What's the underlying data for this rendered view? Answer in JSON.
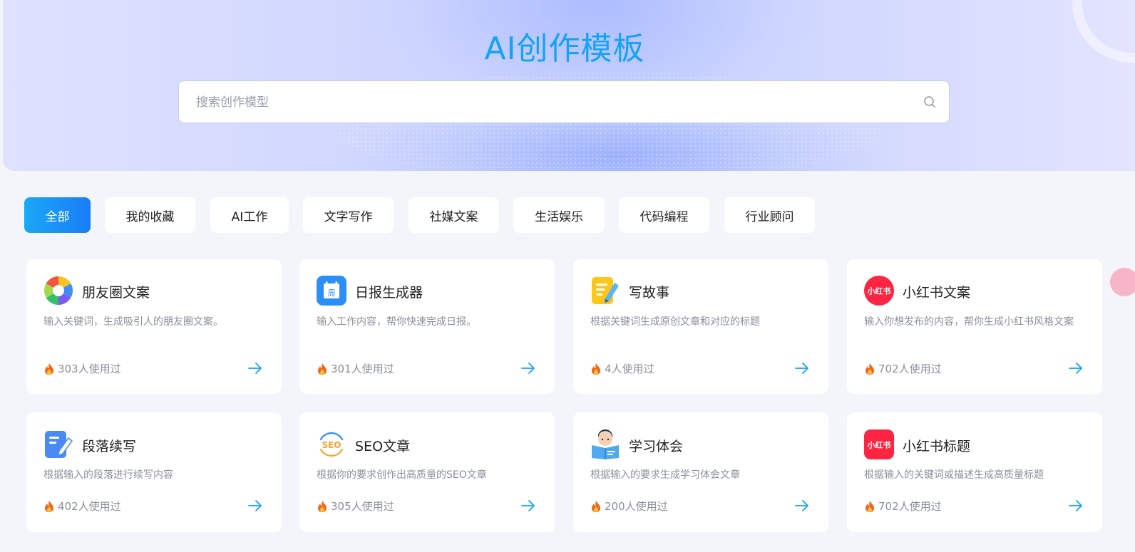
{
  "header": {
    "title": "AI创作模板",
    "search_placeholder": "搜索创作模型",
    "search_icon": "search-icon"
  },
  "tabs": [
    {
      "label": "全部",
      "active": true
    },
    {
      "label": "我的收藏",
      "active": false
    },
    {
      "label": "AI工作",
      "active": false
    },
    {
      "label": "文字写作",
      "active": false
    },
    {
      "label": "社媒文案",
      "active": false
    },
    {
      "label": "生活娱乐",
      "active": false
    },
    {
      "label": "代码编程",
      "active": false
    },
    {
      "label": "行业顾问",
      "active": false
    }
  ],
  "cards": [
    {
      "name": "朋友圈文案",
      "desc": "输入关键词，生成吸引人的朋友圈文案。",
      "usage": "303人使用过",
      "icon": "camera-aperture-icon"
    },
    {
      "name": "日报生成器",
      "desc": "输入工作内容，帮你快速完成日报。",
      "usage": "301人使用过",
      "icon": "calendar-icon",
      "icon_text": "周"
    },
    {
      "name": "写故事",
      "desc": "根据关键词生成原创文章和对应的标题",
      "usage": "4人使用过",
      "icon": "notepad-pencil-icon"
    },
    {
      "name": "小红书文案",
      "desc": "输入你想发布的内容，帮你生成小红书风格文案",
      "usage": "702人使用过",
      "icon": "xiaohongshu-icon",
      "icon_text": "小红书"
    },
    {
      "name": "段落续写",
      "desc": "根据输入的段落进行续写内容",
      "usage": "402人使用过",
      "icon": "document-pen-icon"
    },
    {
      "name": "SEO文章",
      "desc": "根据你的要求创作出高质量的SEO文章",
      "usage": "305人使用过",
      "icon": "seo-icon",
      "icon_text": "SEO"
    },
    {
      "name": "学习体会",
      "desc": "根据输入的要求生成学习体会文章",
      "usage": "200人使用过",
      "icon": "student-reading-icon"
    },
    {
      "name": "小红书标题",
      "desc": "根据输入的关键词或描述生成高质量标题",
      "usage": "702人使用过",
      "icon": "xiaohongshu-icon",
      "icon_text": "小红书"
    }
  ],
  "colors": {
    "accent": "#14a3f5",
    "tab_active_start": "#1aa8f7",
    "tab_active_end": "#1a7df8",
    "background": "#f3f5fa",
    "fire": "#f2651c",
    "xiaohongshu_red": "#ff2442"
  }
}
